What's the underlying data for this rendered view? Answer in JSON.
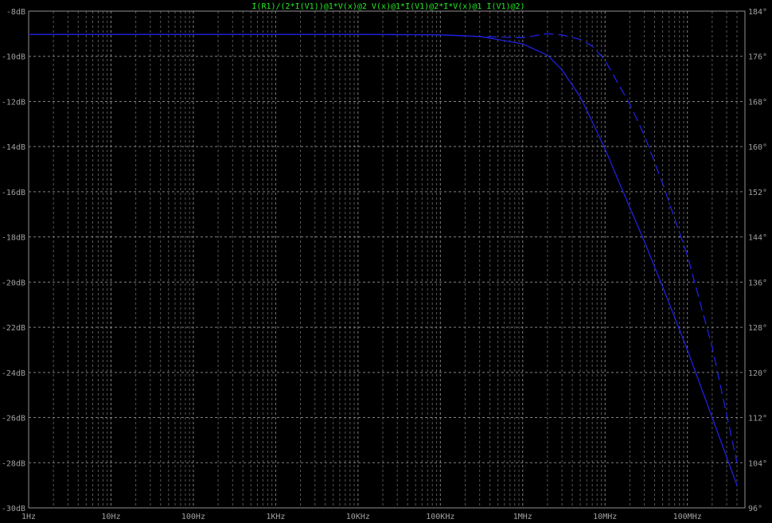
{
  "chart_data": {
    "type": "line",
    "title": "I(R1)/(2*I(V1))@1*V(x)@2 V(x)@1*I(V1)@2*I*V(x)@1 I(V1)@2)",
    "x_scale": "log",
    "xlim": [
      1,
      500000000
    ],
    "x_ticks": [
      {
        "value": 1,
        "label": "1Hz"
      },
      {
        "value": 10,
        "label": "10Hz"
      },
      {
        "value": 100,
        "label": "100Hz"
      },
      {
        "value": 1000,
        "label": "1KHz"
      },
      {
        "value": 10000,
        "label": "10KHz"
      },
      {
        "value": 100000,
        "label": "100KHz"
      },
      {
        "value": 1000000,
        "label": "1MHz"
      },
      {
        "value": 10000000,
        "label": "10MHz"
      },
      {
        "value": 100000000,
        "label": "100MHz"
      }
    ],
    "y_left": {
      "ylim": [
        -30,
        -8
      ],
      "ticks": [
        {
          "value": -8,
          "label": "-8dB"
        },
        {
          "value": -10,
          "label": "-10dB"
        },
        {
          "value": -12,
          "label": "-12dB"
        },
        {
          "value": -14,
          "label": "-14dB"
        },
        {
          "value": -16,
          "label": "-16dB"
        },
        {
          "value": -18,
          "label": "-18dB"
        },
        {
          "value": -20,
          "label": "-20dB"
        },
        {
          "value": -22,
          "label": "-22dB"
        },
        {
          "value": -24,
          "label": "-24dB"
        },
        {
          "value": -26,
          "label": "-26dB"
        },
        {
          "value": -28,
          "label": "-28dB"
        },
        {
          "value": -30,
          "label": "-30dB"
        }
      ]
    },
    "y_right": {
      "ylim": [
        96,
        184
      ],
      "ticks": [
        {
          "value": 184,
          "label": "184°"
        },
        {
          "value": 176,
          "label": "176°"
        },
        {
          "value": 168,
          "label": "168°"
        },
        {
          "value": 160,
          "label": "160°"
        },
        {
          "value": 152,
          "label": "152°"
        },
        {
          "value": 144,
          "label": "144°"
        },
        {
          "value": 136,
          "label": "136°"
        },
        {
          "value": 128,
          "label": "128°"
        },
        {
          "value": 120,
          "label": "120°"
        },
        {
          "value": 112,
          "label": "112°"
        },
        {
          "value": 104,
          "label": "104°"
        },
        {
          "value": 96,
          "label": "96°"
        }
      ]
    },
    "grid": true,
    "colors": {
      "background": "#000000",
      "grid": "#909090",
      "trace": "#2020e0",
      "title": "#22ee22",
      "tick": "#a0a0a0"
    },
    "series": [
      {
        "axis": "left",
        "style": "solid",
        "x": [
          1,
          10,
          100,
          1000,
          10000,
          100000,
          300000,
          1000000,
          2000000,
          3000000,
          5000000,
          7000000,
          10000000,
          20000000,
          30000000,
          50000000,
          100000000,
          200000000,
          400000000
        ],
        "y": [
          -9.03,
          -9.03,
          -9.03,
          -9.03,
          -9.03,
          -9.05,
          -9.12,
          -9.45,
          -9.95,
          -10.6,
          -11.8,
          -12.9,
          -14.1,
          -16.7,
          -18.2,
          -20.2,
          -23.0,
          -26.0,
          -29.0
        ]
      },
      {
        "axis": "right",
        "style": "dashed",
        "x": [
          1,
          10,
          100,
          1000,
          10000,
          100000,
          150000,
          300000,
          1000000,
          2000000,
          3000000,
          5000000,
          7000000,
          10000000,
          20000000,
          30000000,
          50000000,
          100000000,
          200000000,
          400000000
        ],
        "y": [
          179.9,
          179.9,
          179.9,
          179.9,
          179.9,
          179.8,
          179.7,
          179.5,
          179.3,
          180.0,
          179.8,
          179.0,
          177.8,
          175.3,
          167.5,
          162.0,
          153.5,
          140.7,
          124.5,
          104.0
        ]
      }
    ]
  }
}
